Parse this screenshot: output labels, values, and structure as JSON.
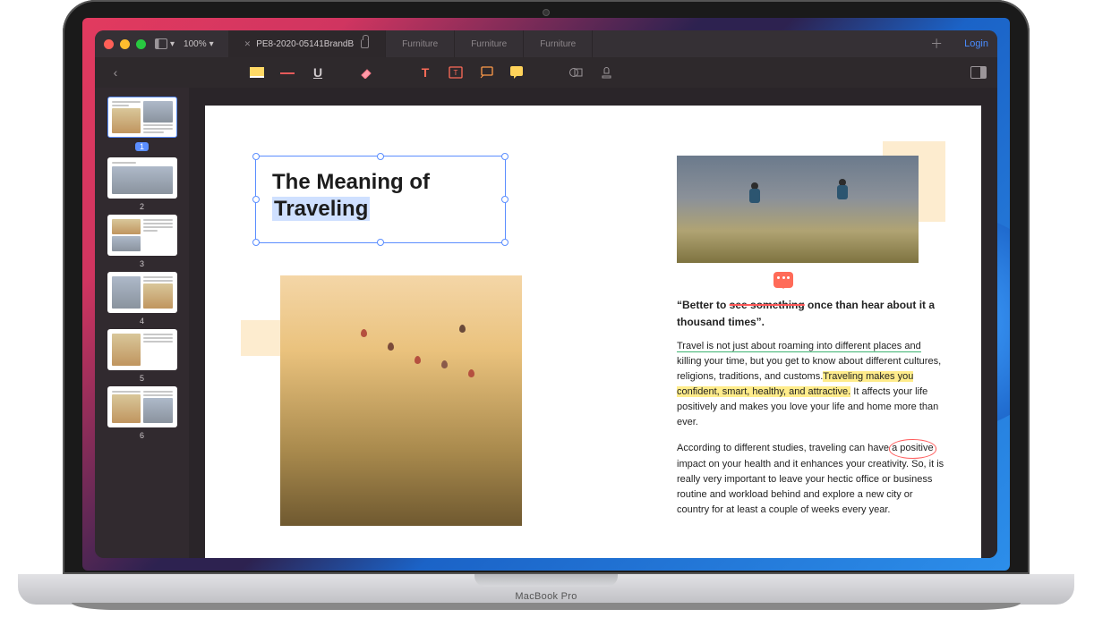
{
  "device_label": "MacBook Pro",
  "titlebar": {
    "zoom": "100%",
    "tabs": [
      {
        "label": "PE8-2020-05141BrandB",
        "active": true,
        "locked": true
      },
      {
        "label": "Furniture"
      },
      {
        "label": "Furniture"
      },
      {
        "label": "Furniture"
      }
    ],
    "login": "Login"
  },
  "sidebar": {
    "pages": [
      "1",
      "2",
      "3",
      "4",
      "5",
      "6"
    ],
    "active_index": 0
  },
  "document": {
    "title_line1": "The Meaning of",
    "title_hl": "Traveling",
    "quote_prefix": "“Better to ",
    "quote_squiggle": "see something",
    "quote_suffix": " once than hear about it a thousand times”.",
    "p1_u": "Travel is not just about roaming into different places and",
    "p1_a": " killing your time, but you get to know about different cultures, religions, traditions, and customs.",
    "p1_hl": "Traveling makes you confident, smart, healthy, and attractive.",
    "p1_b": " It affects your life positively and makes you love your life and home more than ever.",
    "p2_a": "According to different studies, traveling can have ",
    "p2_circle": "a positive",
    "p2_b": " impact on your health and it enhances your creativity. So, it is really very important to leave your hectic office or business routine and workload behind and explore a new city or country for at least a couple of weeks every year."
  }
}
